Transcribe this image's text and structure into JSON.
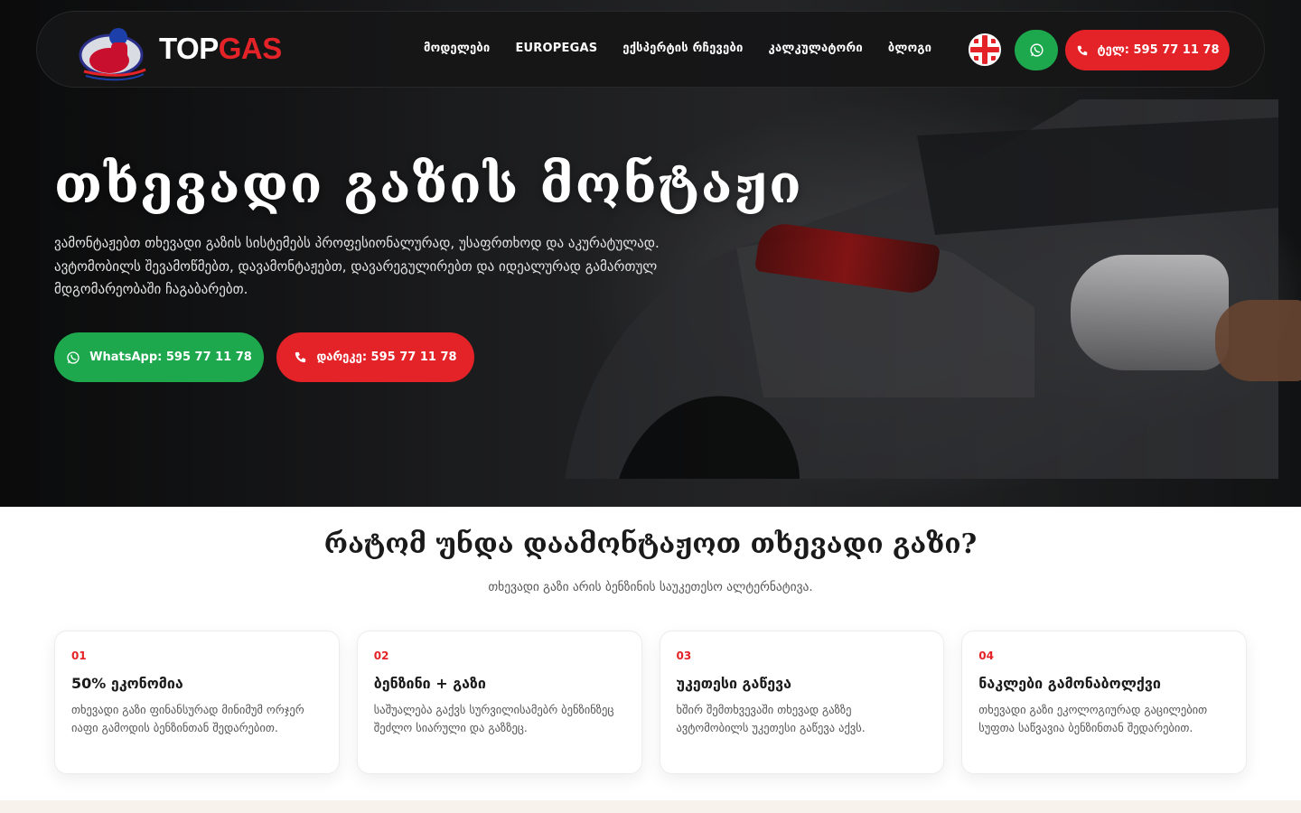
{
  "brand": {
    "logo_top": "TOP",
    "logo_gas": "GAS",
    "accent": "#e32327",
    "green": "#1ea84e"
  },
  "nav": {
    "items": [
      "მოდელები",
      "EUROPEGAS",
      "ექსპერტის რჩევები",
      "კალკულატორი",
      "ბლოგი"
    ],
    "language_icon": "georgia-flag-icon",
    "whatsapp_icon": "whatsapp-icon",
    "phone_button": "ტელ: 595 77 11 78"
  },
  "hero": {
    "title": "თხევადი გაზის მონტაჟი",
    "description": "ვამონტაჟებთ თხევადი გაზის სისტემებს პროფესიონალურად, უსაფრთხოდ და აკურატულად. ავტომობილს შევამოწმებთ, დავამონტაჟებთ, დავარეგულირებთ და იდეალურად გამართულ მდგომარეობაში ჩაგაბარებთ.",
    "whatsapp_button": "WhatsApp: 595 77 11 78",
    "call_button": "დარეკე: 595 77 11 78"
  },
  "why": {
    "title": "რატომ უნდა დაამონტაჟოთ თხევადი გაზი?",
    "subtitle": "თხევადი გაზი არის ბენზინის საუკეთესო ალტერნატივა.",
    "cards": [
      {
        "num": "01",
        "title": "50% ეკონომია",
        "text": "თხევადი გაზი ფინანსურად მინიმუმ ორჯერ იაფი გამოდის ბენზინთან შედარებით."
      },
      {
        "num": "02",
        "title": "ბენზინი + გაზი",
        "text": "საშუალება გაქვს სურვილისამებრ ბენზინზეც შეძლო სიარული და გაზზეც."
      },
      {
        "num": "03",
        "title": "უკეთესი გაწევა",
        "text": "ხშირ შემთხვევაში თხევად გაზზე ავტომობილს უკეთესი გაწევა აქვს."
      },
      {
        "num": "04",
        "title": "ნაკლები გამონაბოლქვი",
        "text": "თხევადი გაზი ეკოლოგიურად გაცილებით სუფთა საწვავია ბენზინთან შედარებით."
      }
    ]
  }
}
